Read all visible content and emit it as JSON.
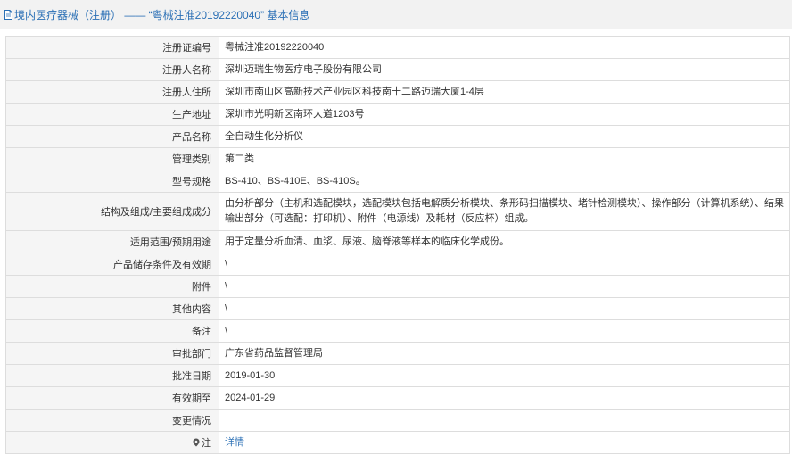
{
  "header": {
    "title": "境内医疗器械（注册） —— “粤械注准20192220040” 基本信息"
  },
  "rows": [
    {
      "label": "注册证编号",
      "value": "粤械注准20192220040"
    },
    {
      "label": "注册人名称",
      "value": "深圳迈瑞生物医疗电子股份有限公司"
    },
    {
      "label": "注册人住所",
      "value": "深圳市南山区高新技术产业园区科技南十二路迈瑞大厦1-4层"
    },
    {
      "label": "生产地址",
      "value": "深圳市光明新区南环大道1203号"
    },
    {
      "label": "产品名称",
      "value": "全自动生化分析仪"
    },
    {
      "label": "管理类别",
      "value": "第二类"
    },
    {
      "label": "型号规格",
      "value": "BS-410、BS-410E、BS-410S。"
    },
    {
      "label": "结构及组成/主要组成成分",
      "value": "由分析部分（主机和选配模块，选配模块包括电解质分析模块、条形码扫描模块、堵针检测模块）、操作部分（计算机系统）、结果输出部分（可选配：打印机）、附件（电源线）及耗材（反应杯）组成。"
    },
    {
      "label": "适用范围/预期用途",
      "value": "用于定量分析血清、血浆、尿液、脑脊液等样本的临床化学成份。"
    },
    {
      "label": "产品储存条件及有效期",
      "value": "\\"
    },
    {
      "label": "附件",
      "value": "\\"
    },
    {
      "label": "其他内容",
      "value": "\\"
    },
    {
      "label": "备注",
      "value": "\\"
    },
    {
      "label": "审批部门",
      "value": "广东省药品监督管理局"
    },
    {
      "label": "批准日期",
      "value": "2019-01-30"
    },
    {
      "label": "有效期至",
      "value": "2024-01-29"
    },
    {
      "label": "变更情况",
      "value": ""
    }
  ],
  "note": {
    "label": "注",
    "icon": "pin-icon",
    "link_text": "详情"
  }
}
